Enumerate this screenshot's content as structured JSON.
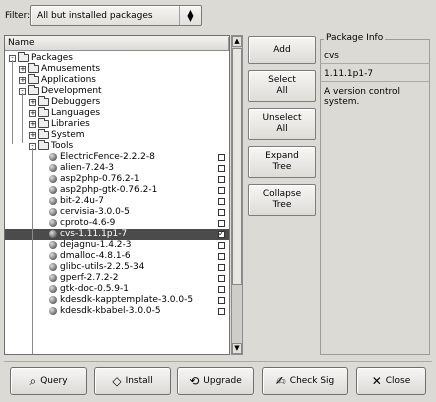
{
  "filter": {
    "label": "Filter:",
    "selected": "All but installed packages",
    "arrows_icon": "up-down-arrows-icon"
  },
  "tree": {
    "column_header": "Name",
    "rows": [
      {
        "label": "Packages",
        "depth": 0,
        "kind": "folder",
        "expander": "-"
      },
      {
        "label": "Amusements",
        "depth": 1,
        "kind": "folder",
        "expander": "+"
      },
      {
        "label": "Applications",
        "depth": 1,
        "kind": "folder",
        "expander": "+"
      },
      {
        "label": "Development",
        "depth": 1,
        "kind": "folder",
        "expander": "-"
      },
      {
        "label": "Debuggers",
        "depth": 2,
        "kind": "folder",
        "expander": "+"
      },
      {
        "label": "Languages",
        "depth": 2,
        "kind": "folder",
        "expander": "+"
      },
      {
        "label": "Libraries",
        "depth": 2,
        "kind": "folder",
        "expander": "+"
      },
      {
        "label": "System",
        "depth": 2,
        "kind": "folder",
        "expander": "+"
      },
      {
        "label": "Tools",
        "depth": 2,
        "kind": "folder",
        "expander": "-"
      },
      {
        "label": "ElectricFence-2.2.2-8",
        "depth": 3,
        "kind": "pkg",
        "checked": false
      },
      {
        "label": "alien-7.24-3",
        "depth": 3,
        "kind": "pkg",
        "checked": false
      },
      {
        "label": "asp2php-0.76.2-1",
        "depth": 3,
        "kind": "pkg",
        "checked": false
      },
      {
        "label": "asp2php-gtk-0.76.2-1",
        "depth": 3,
        "kind": "pkg",
        "checked": false
      },
      {
        "label": "bit-2.4u-7",
        "depth": 3,
        "kind": "pkg",
        "checked": false
      },
      {
        "label": "cervisia-3.0.0-5",
        "depth": 3,
        "kind": "pkg",
        "checked": false
      },
      {
        "label": "cproto-4.6-9",
        "depth": 3,
        "kind": "pkg",
        "checked": false
      },
      {
        "label": "cvs-1.11.1p1-7",
        "depth": 3,
        "kind": "pkg",
        "checked": true,
        "selected": true
      },
      {
        "label": "dejagnu-1.4.2-3",
        "depth": 3,
        "kind": "pkg",
        "checked": false
      },
      {
        "label": "dmalloc-4.8.1-6",
        "depth": 3,
        "kind": "pkg",
        "checked": false
      },
      {
        "label": "glibc-utils-2.2.5-34",
        "depth": 3,
        "kind": "pkg",
        "checked": false
      },
      {
        "label": "gperf-2.7.2-2",
        "depth": 3,
        "kind": "pkg",
        "checked": false
      },
      {
        "label": "gtk-doc-0.5.9-1",
        "depth": 3,
        "kind": "pkg",
        "checked": false
      },
      {
        "label": "kdesdk-kapptemplate-3.0.0-5",
        "depth": 3,
        "kind": "pkg",
        "checked": false
      },
      {
        "label": "kdesdk-kbabel-3.0.0-5",
        "depth": 3,
        "kind": "pkg",
        "checked": false
      }
    ]
  },
  "side_buttons": {
    "add": "Add",
    "select_all": [
      "Select",
      "All"
    ],
    "unselect_all": [
      "Unselect",
      "All"
    ],
    "expand_tree": [
      "Expand",
      "Tree"
    ],
    "collapse_tree": [
      "Collapse",
      "Tree"
    ]
  },
  "package_info": {
    "title": "Package Info",
    "name": "cvs",
    "version": "1.11.1p1-7",
    "description": "A version control system."
  },
  "bottom_buttons": {
    "query": {
      "label": "Query",
      "icon": "magnifier-icon"
    },
    "install": {
      "label": "Install",
      "icon": "disk-icon"
    },
    "upgrade": {
      "label": "Upgrade",
      "icon": "refresh-icon"
    },
    "check_sig": {
      "label": "Check Sig",
      "icon": "signature-icon"
    },
    "close": {
      "label": "Close",
      "icon": "close-icon"
    }
  }
}
